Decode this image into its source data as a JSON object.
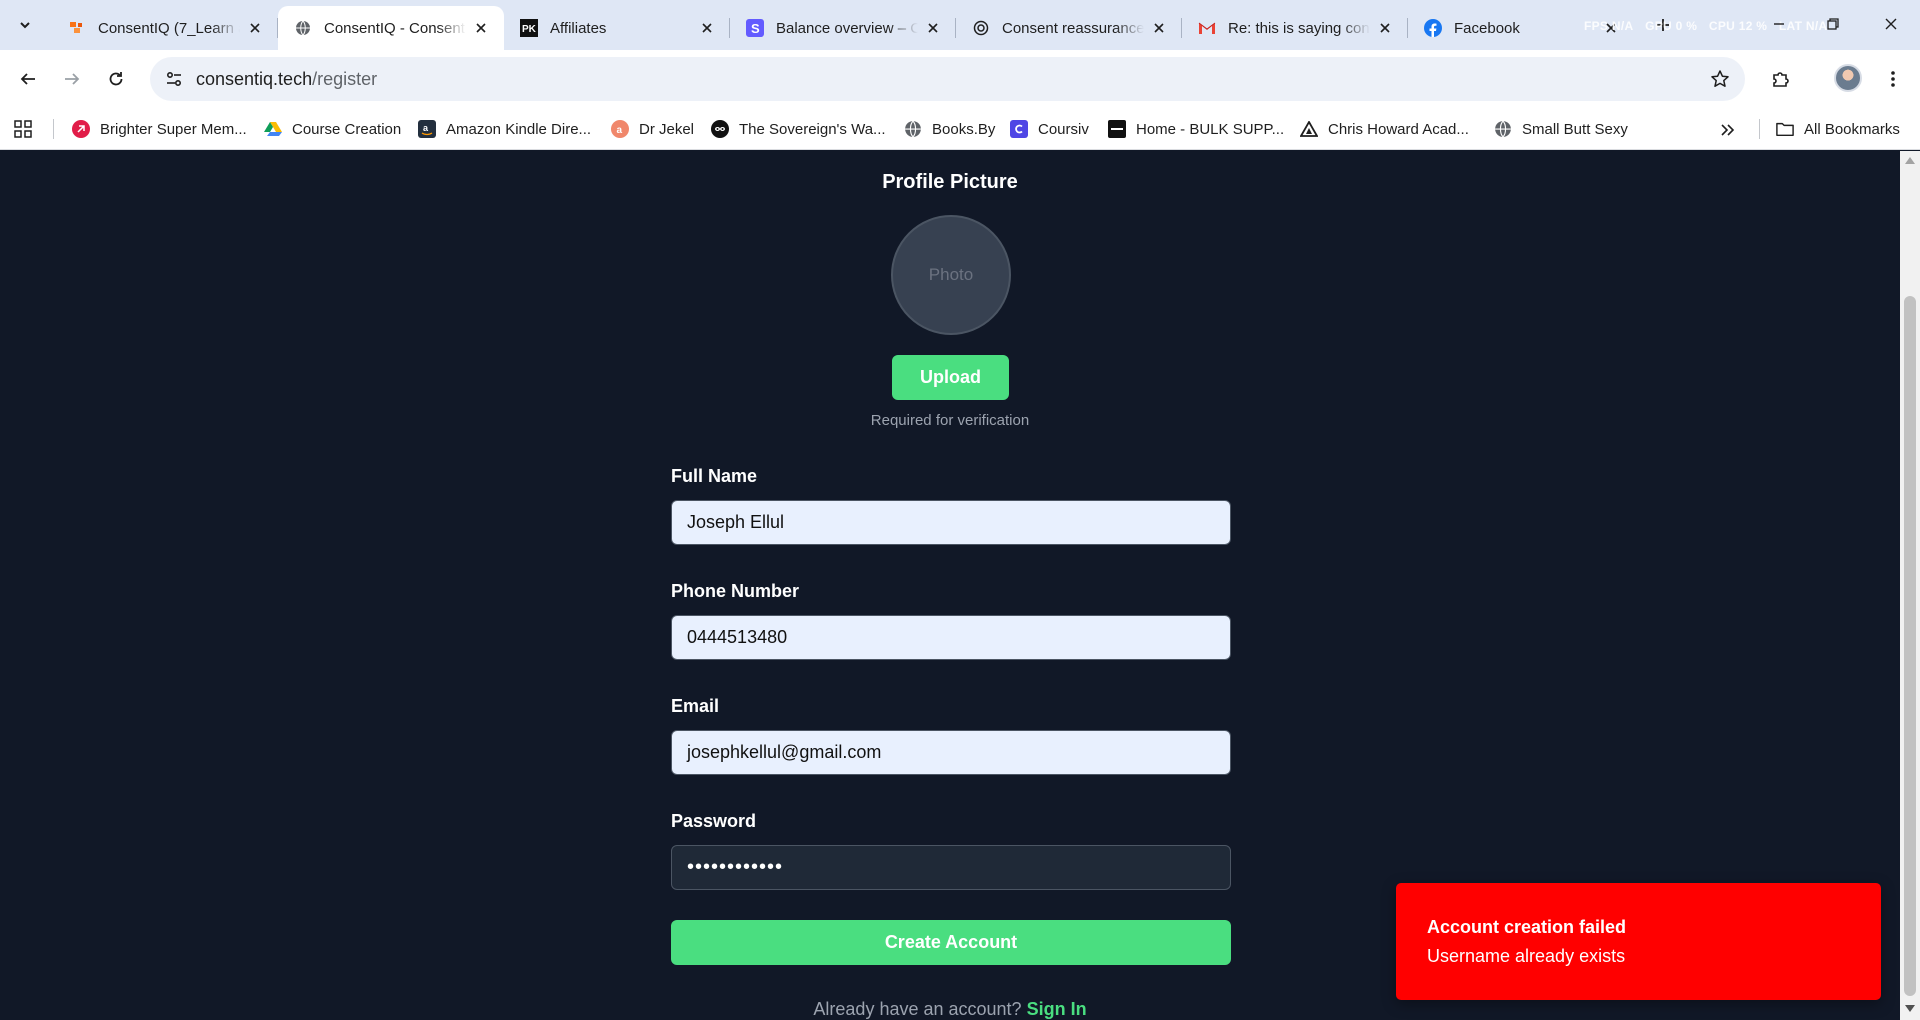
{
  "browser": {
    "tabs": [
      {
        "title": "ConsentIQ (7_Learn a",
        "icon": "consentiq-orange-icon",
        "active": false
      },
      {
        "title": "ConsentIQ - Consent",
        "icon": "globe-icon",
        "active": true
      },
      {
        "title": "Affiliates",
        "icon": "pk-logo-icon",
        "active": false
      },
      {
        "title": "Balance overview – C",
        "icon": "stripe-s-icon",
        "active": false
      },
      {
        "title": "Consent reassurance",
        "icon": "openai-icon",
        "active": false
      },
      {
        "title": "Re: this is saying con",
        "icon": "gmail-icon",
        "active": false
      },
      {
        "title": "Facebook",
        "icon": "facebook-icon",
        "active": false
      }
    ],
    "perf_overlay": {
      "fps": "FPS N/A",
      "gpu": "GPU 0 %",
      "cpu": "CPU 12 %",
      "lat": "LAT N/A"
    },
    "address": {
      "domain": "consentiq.tech",
      "path": "/register"
    },
    "bookmarks": [
      {
        "label": "Brighter Super Mem...",
        "icon": "brighter-icon"
      },
      {
        "label": "Course Creation",
        "icon": "google-drive-icon"
      },
      {
        "label": "Amazon Kindle Dire...",
        "icon": "amazon-icon"
      },
      {
        "label": "Dr Jekel",
        "icon": "dr-jekel-icon"
      },
      {
        "label": "The Sovereign's Wa...",
        "icon": "sovereign-icon"
      },
      {
        "label": "Books.By",
        "icon": "globe-icon"
      },
      {
        "label": "Coursiv",
        "icon": "coursiv-icon"
      },
      {
        "label": "Home - BULK SUPP...",
        "icon": "bulk-icon"
      },
      {
        "label": "Chris Howard Acad...",
        "icon": "triangle-icon"
      },
      {
        "label": "Small Butt Sexy",
        "icon": "globe-icon"
      }
    ],
    "all_bookmarks_label": "All Bookmarks"
  },
  "form": {
    "profile_picture_title": "Profile Picture",
    "photo_placeholder": "Photo",
    "upload_label": "Upload",
    "required_note": "Required for verification",
    "full_name_label": "Full Name",
    "full_name_value": "Joseph Ellul",
    "phone_label": "Phone Number",
    "phone_value": "0444513480",
    "email_label": "Email",
    "email_value": "josephkellul@gmail.com",
    "password_label": "Password",
    "password_value": "••••••••••••",
    "create_label": "Create Account",
    "signin_prompt": "Already have an account?",
    "signin_link": "Sign In"
  },
  "toast": {
    "title": "Account creation failed",
    "message": "Username already exists"
  },
  "colors": {
    "page_bg": "#111827",
    "accent_green": "#4ade80",
    "error_red": "#ff0000"
  }
}
